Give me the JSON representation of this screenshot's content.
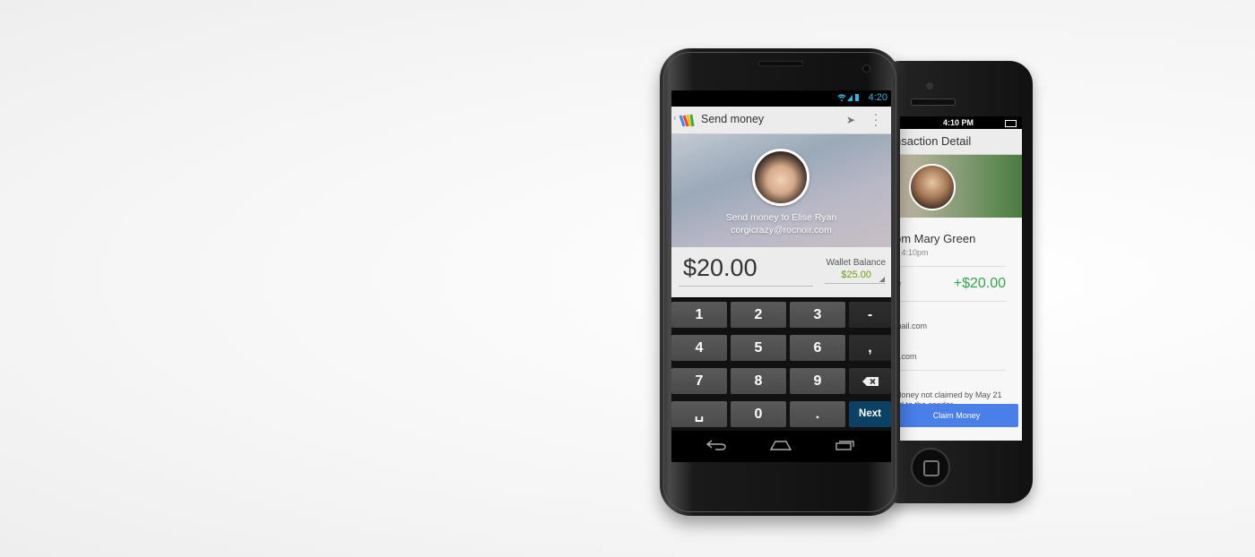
{
  "iphone": {
    "status_time": "4:10 PM",
    "title": "nsaction Detail",
    "from": "om Mary Green",
    "time": "3 4:10pm",
    "amount_label": "er",
    "amount": "+$20.00",
    "email1": "mail.com",
    "email2": "e.com",
    "note_line1": "Money not claimed by May 21",
    "note_line2": "ed to the sender",
    "claim_button": "Claim Money",
    "colors": {
      "amount": "#2ea84a",
      "claim": "#4a7ee8"
    }
  },
  "nexus": {
    "status_time": "4:20",
    "status_icons": "wifi-signal-battery",
    "action_title": "Send money",
    "send_to": "Send money to Elise Ryan",
    "email": "corgicrazy@rocnoir.com",
    "amount": "$20.00",
    "wallet_label": "Wallet Balance",
    "wallet_value": "$25.00",
    "keys": {
      "k1": "1",
      "k2": "2",
      "k3": "3",
      "kminus": "-",
      "k4": "4",
      "k5": "5",
      "k6": "6",
      "kcomma": ",",
      "k7": "7",
      "k8": "8",
      "k9": "9",
      "kspace": "␣",
      "k0": "0",
      "kdot": ".",
      "knext": "Next"
    },
    "colors": {
      "accent": "#33b5e5",
      "wallet": "#6aa20f",
      "next": "#0c4166"
    }
  }
}
